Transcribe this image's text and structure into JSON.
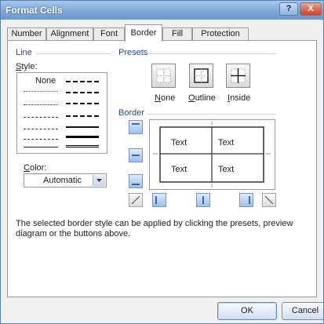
{
  "window": {
    "title": "Format Cells",
    "help_button": "?",
    "close_button": "X"
  },
  "tabs": [
    "Number",
    "Alignment",
    "Font",
    "Border",
    "Fill",
    "Protection"
  ],
  "active_tab": "Border",
  "line_group": {
    "title": "Line",
    "style_label": "Style:",
    "style_none": "None",
    "color_label": "Color:",
    "color_value": "Automatic"
  },
  "presets_group": {
    "title": "Presets",
    "none": "None",
    "outline": "Outline",
    "inside": "Inside"
  },
  "border_group": {
    "title": "Border",
    "cell_text": [
      "Text",
      "Text",
      "Text",
      "Text"
    ]
  },
  "note": "The selected border style can be applied by clicking the presets, preview diagram or the buttons above.",
  "buttons": {
    "ok": "OK",
    "cancel": "Cancel"
  },
  "colors": {
    "group_title": "#1d4a9c",
    "title_bar": "#7fa8d8",
    "button_blue": "#9ec0ec"
  }
}
